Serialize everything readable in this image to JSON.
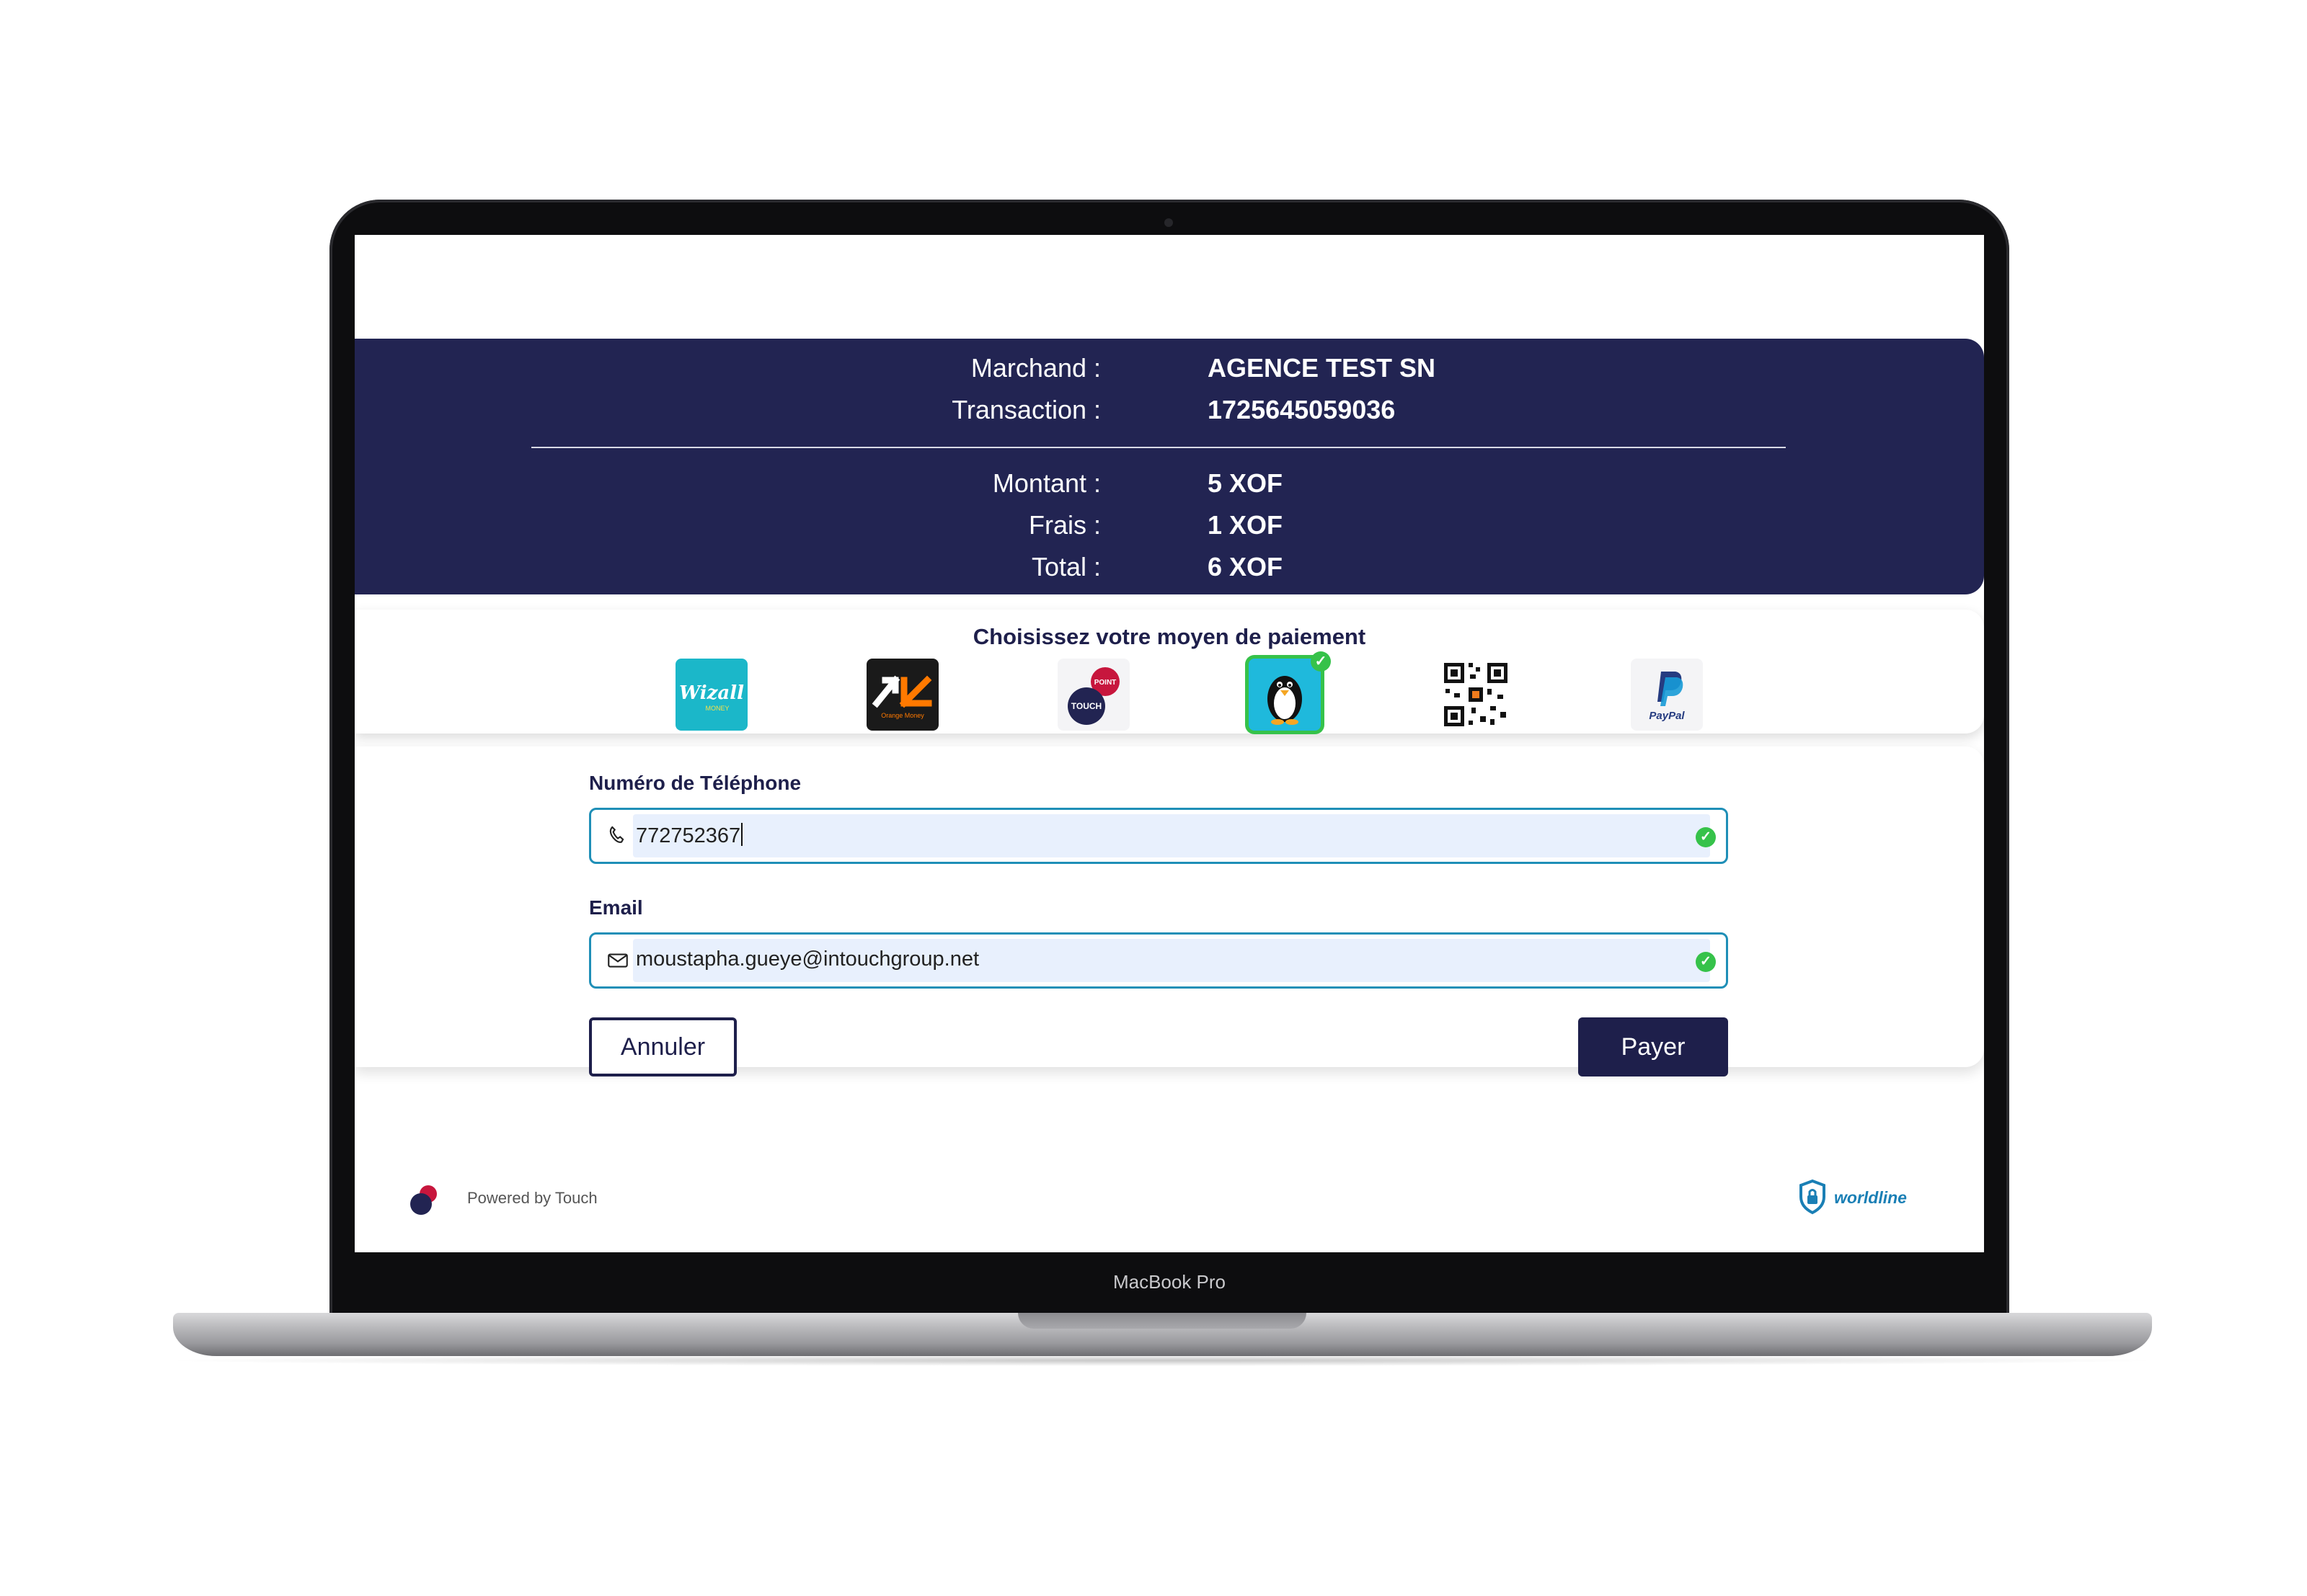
{
  "summary": {
    "merchant_label": "Marchand :",
    "merchant_value": "AGENCE TEST SN",
    "transaction_label": "Transaction :",
    "transaction_value": "1725645059036",
    "amount_label": "Montant :",
    "amount_value": "5 XOF",
    "fees_label": "Frais :",
    "fees_value": "1 XOF",
    "total_label": "Total :",
    "total_value": "6 XOF"
  },
  "payment_methods": {
    "title": "Choisissez votre moyen de paiement",
    "options": [
      {
        "name": "Wizall Money",
        "wordmark": "Wizall",
        "tagline": "MONEY",
        "selected": false
      },
      {
        "name": "Orange Money",
        "tagline": "Orange Money",
        "selected": false
      },
      {
        "name": "Touch Point",
        "badge": "POINT",
        "wordmark": "TOUCH",
        "selected": false
      },
      {
        "name": "Penguin wallet",
        "selected": true
      },
      {
        "name": "QR code",
        "selected": false
      },
      {
        "name": "PayPal",
        "wordmark": "PayPal",
        "selected": false
      }
    ]
  },
  "form": {
    "phone_label": "Numéro de Téléphone",
    "phone_value": "772752367",
    "email_label": "Email",
    "email_value": "moustapha.gueye@intouchgroup.net",
    "cancel_label": "Annuler",
    "pay_label": "Payer"
  },
  "footer": {
    "powered_by": "Powered by Touch",
    "security_brand": "worldline"
  },
  "device": {
    "label": "MacBook Pro"
  },
  "colors": {
    "primary": "#222452",
    "valid": "#36c24a",
    "input_border": "#1f8fb7",
    "input_fill": "#e8f0fd"
  }
}
